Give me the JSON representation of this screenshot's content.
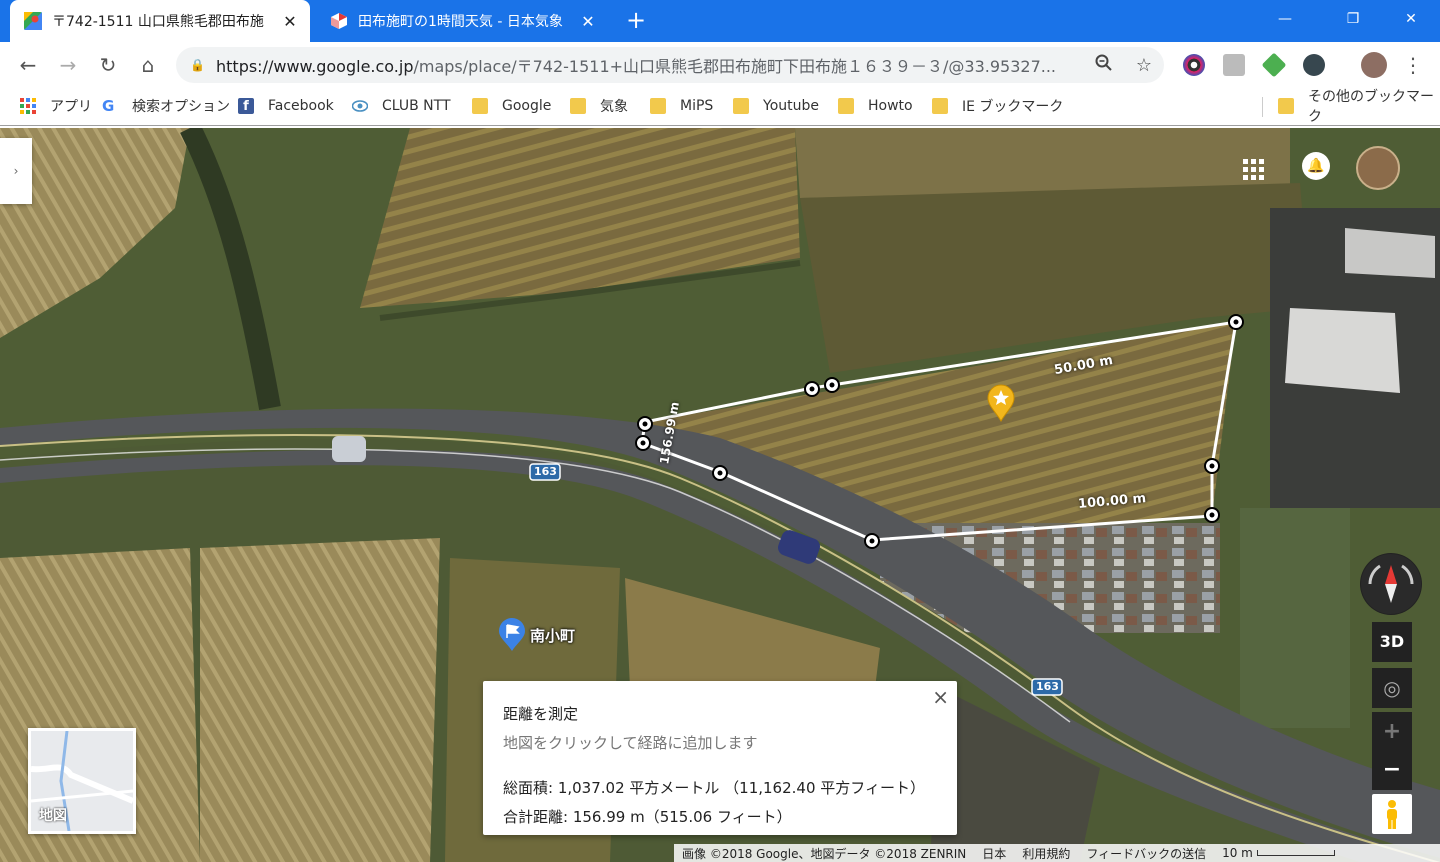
{
  "browser": {
    "tabs": [
      {
        "title": "〒742-1511 山口県熊毛郡田布施",
        "icon": "google-maps-icon"
      },
      {
        "title": "田布施町の1時間天気 - 日本気象",
        "icon": "weather-icon"
      }
    ],
    "new_tab": "+",
    "window_controls": [
      "—",
      "❐",
      "✕"
    ]
  },
  "toolbar": {
    "back": "←",
    "forward": "→",
    "reload": "↻",
    "home": "⌂",
    "url_host": "https://www.google.co.jp",
    "url_path": "/maps/place/〒742-1511+山口県熊毛郡田布施町下田布施１６３９－３/@33.95327...",
    "zoom_icon": "🔍",
    "star": "☆",
    "menu": "⋮"
  },
  "bookmarks": [
    {
      "label": "アプリ",
      "icon": "apps-grid-icon"
    },
    {
      "label": "検索オプション",
      "icon": "google-g-icon"
    },
    {
      "label": "Facebook",
      "icon": "facebook-icon"
    },
    {
      "label": "CLUB NTT",
      "icon": "eye-icon"
    },
    {
      "label": "Google",
      "icon": "folder-icon"
    },
    {
      "label": "気象",
      "icon": "folder-icon"
    },
    {
      "label": "MiPS",
      "icon": "folder-icon"
    },
    {
      "label": "Youtube",
      "icon": "folder-icon"
    },
    {
      "label": "Howto",
      "icon": "folder-icon"
    },
    {
      "label": "IE ブックマーク",
      "icon": "folder-icon"
    },
    {
      "label": "その他のブックマーク",
      "icon": "folder-icon"
    }
  ],
  "map": {
    "labels": {
      "dist_50": "50.00 m",
      "dist_100": "100.00 m",
      "dist_side": "156.99 m",
      "route_163a": "163",
      "route_163b": "163",
      "place": "南小町"
    },
    "controls": {
      "expand": "›",
      "three_d": "3D",
      "locate": "◎",
      "zoom_in": "+",
      "zoom_out": "−"
    },
    "minimap_label": "地図",
    "measure_card": {
      "title": "距離を測定",
      "hint": "地図をクリックして経路に追加します",
      "area": "総面積: 1,037.02 平方メートル （11,162.40 平方フィート）",
      "distance": "合計距離: 156.99 m（515.06 フィート）",
      "close": "×"
    },
    "footer": {
      "imagery": "画像 ©2018 Google、地図データ ©2018 ZENRIN",
      "country": "日本",
      "terms": "利用規約",
      "feedback": "フィードバックの送信",
      "scale": "10 m"
    }
  }
}
